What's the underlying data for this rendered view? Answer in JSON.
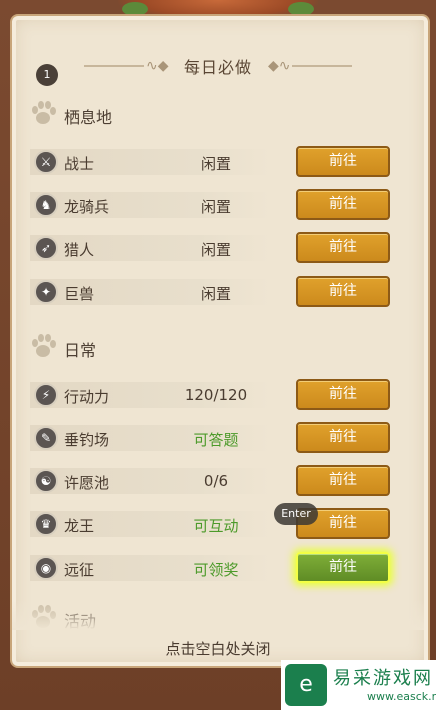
{
  "panel": {
    "title": "每日必做",
    "page_number": "1",
    "close_hint": "点击空白处关闭"
  },
  "sections": [
    {
      "title": "栖息地",
      "rows": [
        {
          "name": "战士",
          "status": "闲置",
          "status_color": "#4a3c30",
          "button": "前往",
          "icon": "warrior-icon",
          "glyph": "⚔"
        },
        {
          "name": "龙骑兵",
          "status": "闲置",
          "status_color": "#4a3c30",
          "button": "前往",
          "icon": "dragoon-icon",
          "glyph": "♞"
        },
        {
          "name": "猎人",
          "status": "闲置",
          "status_color": "#4a3c30",
          "button": "前往",
          "icon": "hunter-icon",
          "glyph": "➶"
        },
        {
          "name": "巨兽",
          "status": "闲置",
          "status_color": "#4a3c30",
          "button": "前往",
          "icon": "beast-icon",
          "glyph": "✦"
        }
      ]
    },
    {
      "title": "日常",
      "rows": [
        {
          "name": "行动力",
          "status": "120/120",
          "status_color": "#4a3c30",
          "button": "前往",
          "icon": "stamina-icon",
          "glyph": "⚡"
        },
        {
          "name": "垂钓场",
          "status": "可答题",
          "status_color": "#4c9a2a",
          "button": "前往",
          "icon": "fishing-icon",
          "glyph": "✎"
        },
        {
          "name": "许愿池",
          "status": "0/6",
          "status_color": "#4a3c30",
          "button": "前往",
          "icon": "wishing-well-icon",
          "glyph": "☯"
        },
        {
          "name": "龙王",
          "status": "可互动",
          "status_color": "#4c9a2a",
          "button": "前往",
          "icon": "dragon-king-icon",
          "glyph": "♛"
        },
        {
          "name": "远征",
          "status": "可领奖",
          "status_color": "#4c9a2a",
          "button": "前往",
          "icon": "expedition-icon",
          "glyph": "◉",
          "highlight": true
        }
      ]
    },
    {
      "title": "活动",
      "rows": []
    }
  ],
  "tooltip": {
    "label": "Enter"
  },
  "watermark": {
    "name": "易采游戏网",
    "url": "www.easck.net",
    "logo_glyph": "e"
  },
  "colors": {
    "paper": "#efe5d2",
    "button": "#d9971f",
    "button_active": "#6e9e2e",
    "highlight_glow": "#e9ff3c",
    "status_green": "#4c9a2a"
  }
}
